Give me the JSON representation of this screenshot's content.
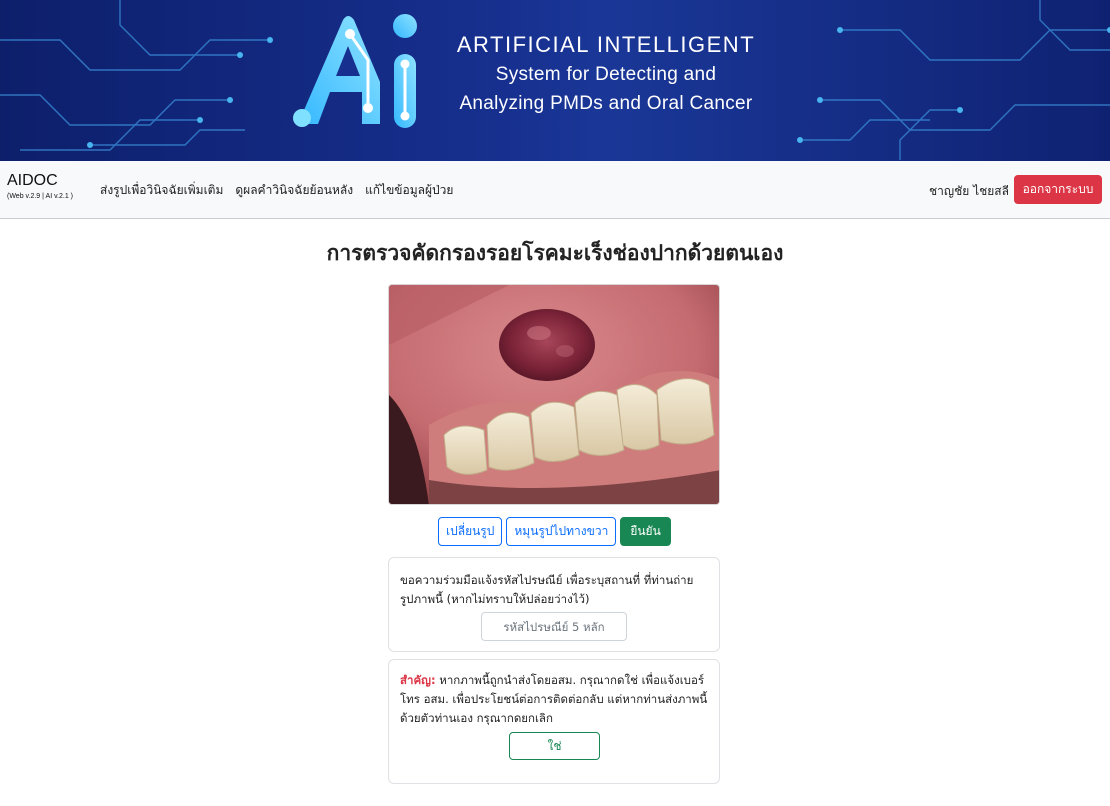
{
  "banner": {
    "title": "ARTIFICIAL INTELLIGENT",
    "subtitle_line1": "System for Detecting and",
    "subtitle_line2": "Analyzing PMDs and Oral Cancer",
    "logo_icon": "ai-logo-icon"
  },
  "navbar": {
    "brand": "AIDOC",
    "version": "(Web v.2.9 | AI v.2.1 )",
    "links": [
      "ส่งรูปเพื่อวินิจฉัยเพิ่มเติม",
      "ดูผลคำวินิจฉัยย้อนหลัง",
      "แก้ไขข้อมูลผู้ป่วย"
    ],
    "user_name": "ชาญชัย ไชยสลี",
    "logout_label": "ออกจากระบบ"
  },
  "main": {
    "title": "การตรวจคัดกรองรอยโรคมะเร็งช่องปากด้วยตนเอง",
    "buttons": {
      "change_image": "เปลี่ยนรูป",
      "rotate_right": "หมุนรูปไปทางขวา",
      "confirm": "ยืนยัน"
    },
    "postcode_card": {
      "text": "ขอความร่วมมือแจ้งรหัสไปรษณีย์ เพื่อระบุสถานที่ ที่ท่านถ่ายรูปภาพนี้ (หากไม่ทราบให้ปล่อยว่างไว้)",
      "placeholder": "รหัสไปรษณีย์ 5 หลัก",
      "value": ""
    },
    "important_card": {
      "label": "สำคัญ:",
      "text": " หากภาพนี้ถูกนำส่งโดยอสม. กรุณากดใช่ เพื่อแจ้งเบอร์โทร อสม. เพื่อประโยชน์ต่อการติดต่อกลับ แต่หากท่านส่งภาพนี้ด้วยตัวท่านเอง กรุณากดยกเลิก",
      "yes_label": "ใช่"
    }
  },
  "colors": {
    "banner": "#17308f",
    "primary": "#0d6efd",
    "success": "#198754",
    "danger": "#dc3545"
  }
}
